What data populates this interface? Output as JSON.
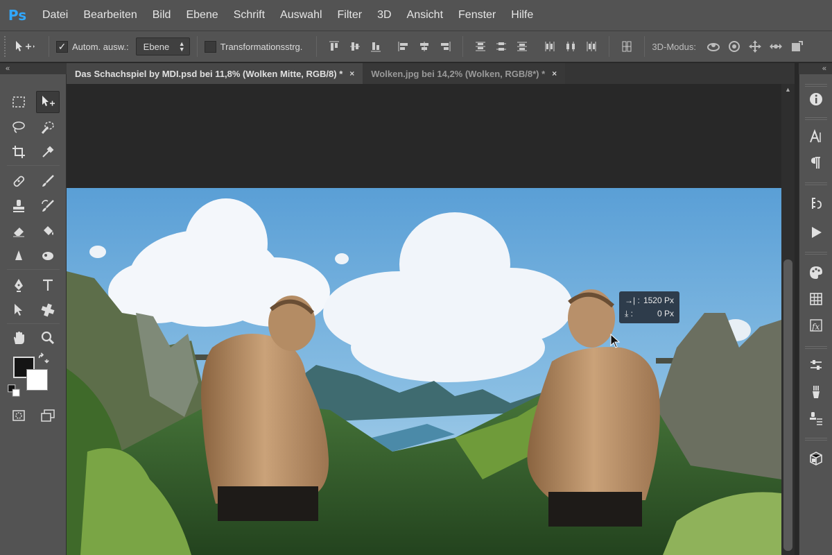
{
  "app": {
    "logo": "Ps"
  },
  "menu": [
    "Datei",
    "Bearbeiten",
    "Bild",
    "Ebene",
    "Schrift",
    "Auswahl",
    "Filter",
    "3D",
    "Ansicht",
    "Fenster",
    "Hilfe"
  ],
  "options": {
    "auto_select_label": "Autom. ausw.:",
    "auto_select_checked": true,
    "auto_select_value": "Ebene",
    "transform_label": "Transformationsstrg.",
    "transform_checked": false,
    "mode_label": "3D-Modus:"
  },
  "tabs": [
    {
      "label": "Das Schachspiel by MDI.psd bei 11,8% (Wolken Mitte, RGB/8) *",
      "active": true,
      "close": "×"
    },
    {
      "label": "Wolken.jpg bei 14,2% (Wolken, RGB/8*) *",
      "active": false,
      "close": "×"
    }
  ],
  "panel_collapse": {
    "left": "«",
    "right": "«"
  },
  "colors": {
    "foreground": "#141414",
    "background": "#ffffff",
    "ui_bg": "#535353",
    "canvas_bg": "#282828"
  },
  "measure": {
    "width_icon": "→|",
    "width_sep": ":",
    "width_value": "1520 Px",
    "height_icon": "⤓",
    "height_sep": ":",
    "height_value": "0 Px"
  }
}
